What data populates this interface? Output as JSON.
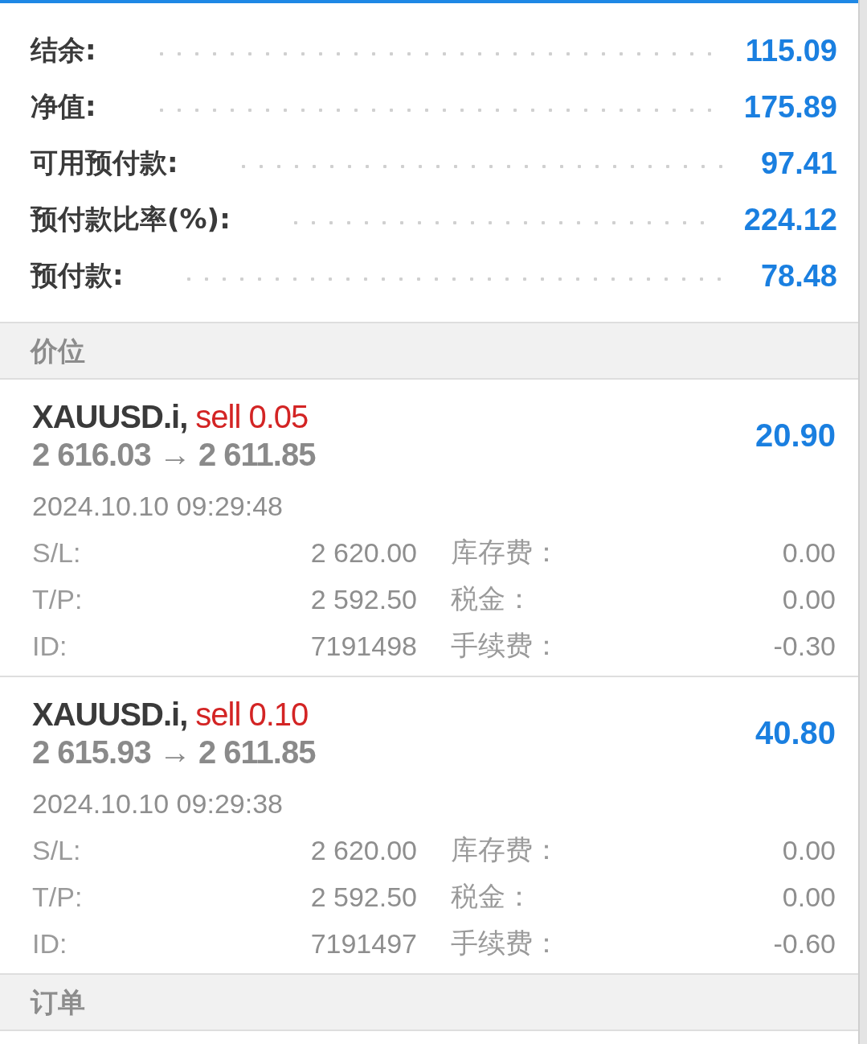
{
  "summary": [
    {
      "label": "结余:",
      "value": "115.09"
    },
    {
      "label": "净值:",
      "value": "175.89"
    },
    {
      "label": "可用预付款:",
      "value": "97.41"
    },
    {
      "label": "预付款比率(%):",
      "value": "224.12"
    },
    {
      "label": "预付款:",
      "value": "78.48"
    }
  ],
  "positions_header": "价位",
  "positions": [
    {
      "symbol": "XAUUSD.i,",
      "trade": "sell 0.05",
      "prices": "2 616.03 → 2 611.85",
      "profit": "20.90",
      "time": "2024.10.10 09:29:48",
      "details": [
        {
          "label": "S/L:",
          "value": "2 620.00",
          "label2": "库存费：",
          "value2": "0.00"
        },
        {
          "label": "T/P:",
          "value": "2 592.50",
          "label2": "税金：",
          "value2": "0.00"
        },
        {
          "label": "ID:",
          "value": "7191498",
          "label2": "手续费：",
          "value2": "-0.30"
        }
      ]
    },
    {
      "symbol": "XAUUSD.i,",
      "trade": "sell 0.10",
      "prices": "2 615.93 → 2 611.85",
      "profit": "40.80",
      "time": "2024.10.10 09:29:38",
      "details": [
        {
          "label": "S/L:",
          "value": "2 620.00",
          "label2": "库存费：",
          "value2": "0.00"
        },
        {
          "label": "T/P:",
          "value": "2 592.50",
          "label2": "税金：",
          "value2": "0.00"
        },
        {
          "label": "ID:",
          "value": "7191497",
          "label2": "手续费：",
          "value2": "-0.60"
        }
      ]
    }
  ],
  "orders_header": "订单"
}
